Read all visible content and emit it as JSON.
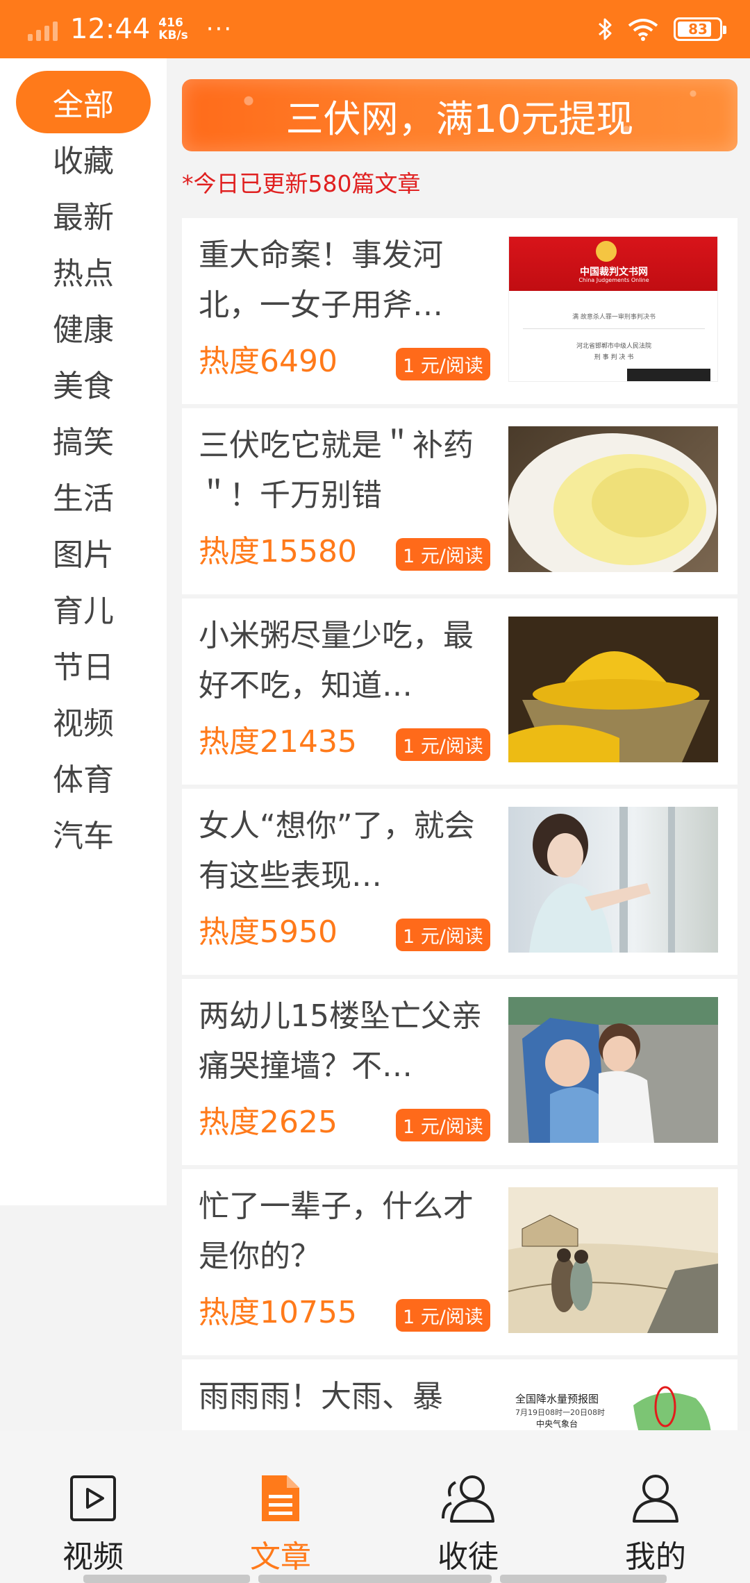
{
  "status_bar": {
    "time": "12:44",
    "speed_value": "416",
    "speed_unit": "KB/s",
    "dots": "···",
    "battery": "83",
    "battery_level": 0.83
  },
  "sidebar": {
    "items": [
      {
        "label": "全部",
        "active": true
      },
      {
        "label": "收藏"
      },
      {
        "label": "最新"
      },
      {
        "label": "热点"
      },
      {
        "label": "健康"
      },
      {
        "label": "美食"
      },
      {
        "label": "搞笑"
      },
      {
        "label": "生活"
      },
      {
        "label": "图片"
      },
      {
        "label": "育儿"
      },
      {
        "label": "节日"
      },
      {
        "label": "视频"
      },
      {
        "label": "体育"
      },
      {
        "label": "汽车"
      }
    ]
  },
  "banner": {
    "text": "三伏网，满10元提现"
  },
  "update_note": "*今日已更新580篇文章",
  "articles": [
    {
      "title": "重大命案！事发河北，一女子用斧…",
      "heat": "热度6490",
      "badge": "1 元/阅读",
      "thumb": "court-document"
    },
    {
      "title": "三伏吃它就是＂补药＂！千万别错",
      "heat": "热度15580",
      "badge": "1 元/阅读",
      "thumb": "bowl"
    },
    {
      "title": "小米粥尽量少吃，最好不吃，知道…",
      "heat": "热度21435",
      "badge": "1 元/阅读",
      "thumb": "millet"
    },
    {
      "title": "女人“想你”了，就会有这些表现…",
      "heat": "热度5950",
      "badge": "1 元/阅读",
      "thumb": "woman"
    },
    {
      "title": "两幼儿15楼坠亡父亲痛哭撞墙？不…",
      "heat": "热度2625",
      "badge": "1 元/阅读",
      "thumb": "children"
    },
    {
      "title": "忙了一辈子，什么才是你的？",
      "heat": "热度10755",
      "badge": "1 元/阅读",
      "thumb": "painting"
    },
    {
      "title": "雨雨雨！大雨、暴雨！大降雨！最…",
      "heat": "",
      "badge": "",
      "thumb": "rain-map"
    }
  ],
  "thumb_text": {
    "court_title": "中国裁判文书网",
    "court_subtitle": "China Judgements Online",
    "court_line1": "满 故意杀人罪一审刑事判决书",
    "court_line2": "河北省邯郸市中级人民法院",
    "court_line3": "刑 事 判 决 书",
    "map_title": "全国降水量预报图",
    "map_date": "7月19日08时一20日08时",
    "map_source": "中央气象台"
  },
  "bottom_nav": [
    {
      "label": "视频",
      "icon": "video-play-icon"
    },
    {
      "label": "文章",
      "icon": "article-document-icon",
      "active": true
    },
    {
      "label": "收徒",
      "icon": "apprentice-users-icon"
    },
    {
      "label": "我的",
      "icon": "profile-user-icon"
    }
  ],
  "colors": {
    "accent": "#ff7a1a",
    "alert": "#e02020"
  }
}
